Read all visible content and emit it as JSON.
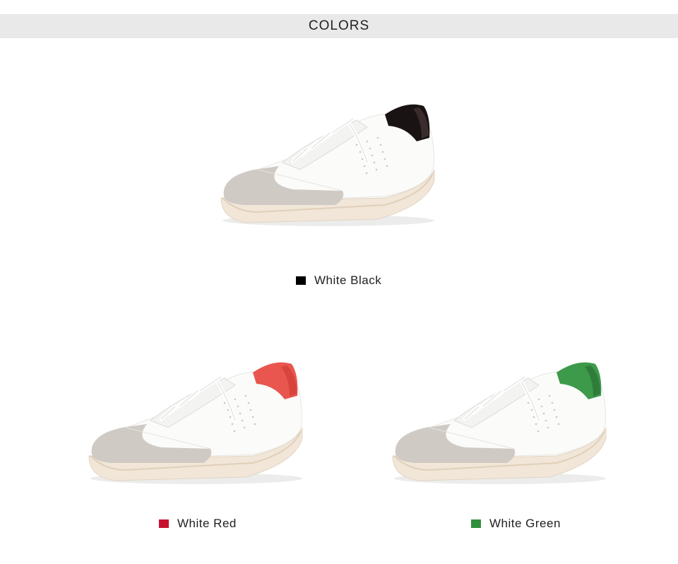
{
  "header": {
    "title": "COLORS"
  },
  "variants": [
    {
      "label": "White Black",
      "swatch_color": "#000000",
      "heel_color": "#1a1313",
      "heel_shade": "#3a2c2c",
      "lining_color": "#0e0b0b"
    },
    {
      "label": "White Red",
      "swatch_color": "#c8102e",
      "heel_color": "#e8564f",
      "heel_shade": "#d8433d",
      "lining_color": "#b8282c"
    },
    {
      "label": "White Green",
      "swatch_color": "#2f8f3b",
      "heel_color": "#3d9a4a",
      "heel_shade": "#2f7d3a",
      "lining_color": "#0f3d18"
    }
  ],
  "colors": {
    "banner": "#e9e9e9",
    "sole": "#f1e6d8",
    "suede": "#cfcac4",
    "upper": "#fbfbfa"
  }
}
